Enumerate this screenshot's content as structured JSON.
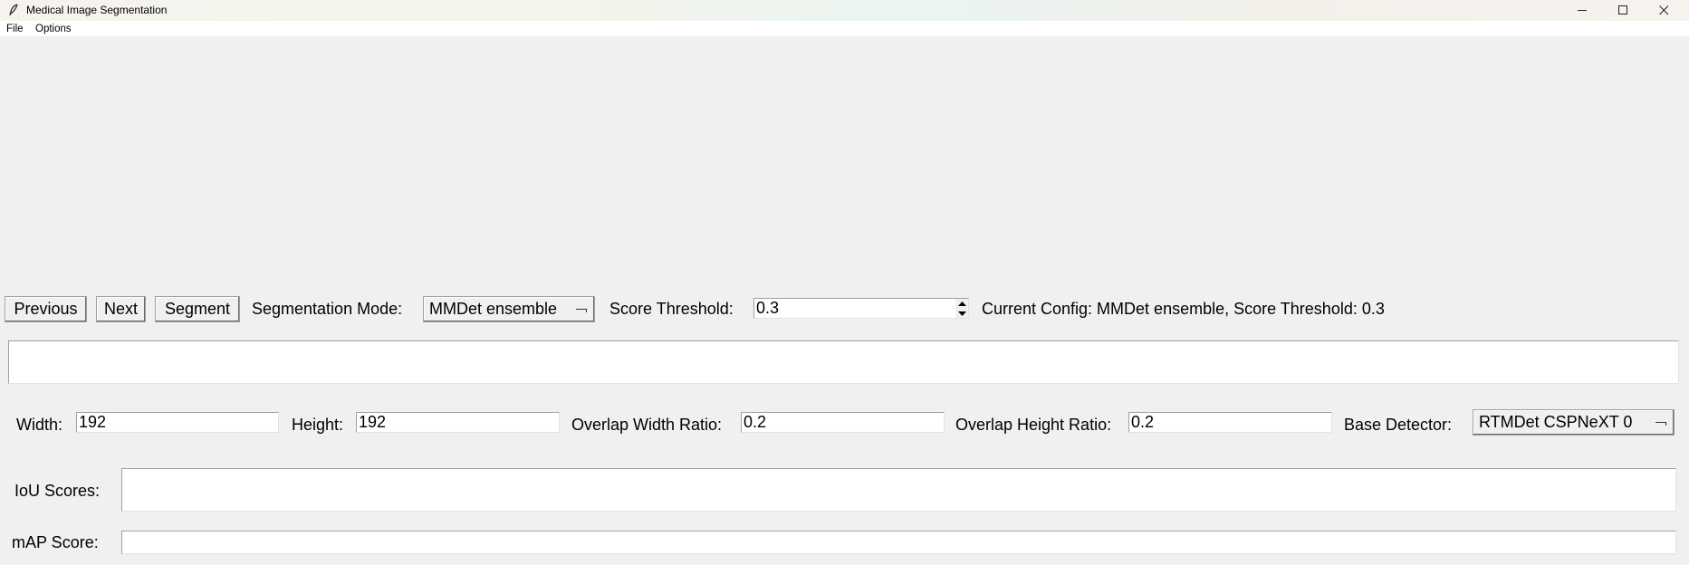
{
  "window": {
    "title": "Medical Image Segmentation",
    "icon": "feather-icon",
    "controls": [
      "minimize-icon",
      "maximize-icon",
      "close-icon"
    ]
  },
  "menubar": {
    "file": "File",
    "options": "Options"
  },
  "toolbar": {
    "previous_label": "Previous",
    "next_label": "Next",
    "segment_label": "Segment",
    "mode_label": "Segmentation Mode:",
    "mode_value": "MMDet ensemble",
    "threshold_label": "Score Threshold:",
    "threshold_value": "0.3",
    "current_config": "Current Config: MMDet ensemble, Score Threshold: 0.3"
  },
  "status_box": {
    "text": ""
  },
  "params": {
    "width_label": "Width:",
    "width_value": "192",
    "height_label": "Height:",
    "height_value": "192",
    "overlap_width_label": "Overlap Width Ratio:",
    "overlap_width_value": "0.2",
    "overlap_height_label": "Overlap Height Ratio:",
    "overlap_height_value": "0.2",
    "base_detector_label": "Base Detector:",
    "base_detector_value": "RTMDet CSPNeXT 0"
  },
  "results": {
    "iou_label": "IoU Scores:",
    "iou_value": "",
    "map_label": "mAP Score:",
    "map_value": ""
  }
}
